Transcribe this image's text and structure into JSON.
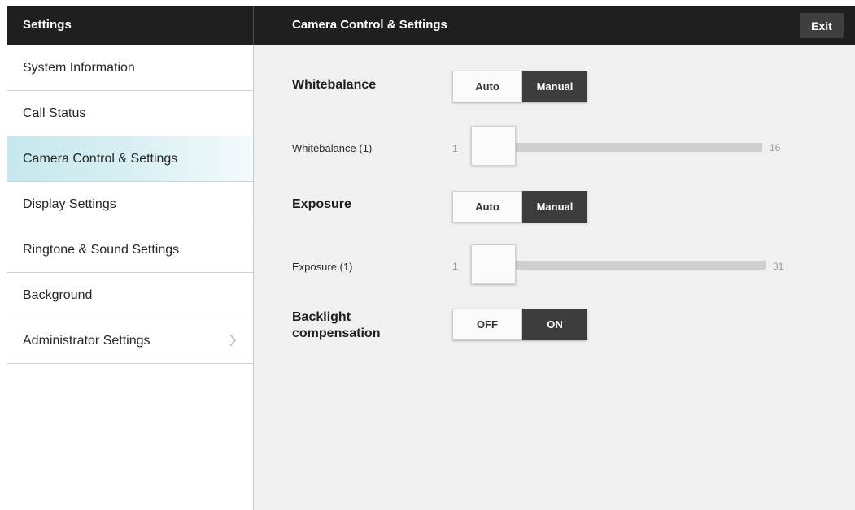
{
  "header": {
    "app_title": "Settings",
    "page_title": "Camera Control & Settings",
    "exit_label": "Exit"
  },
  "sidebar": {
    "items": [
      {
        "label": "System Information"
      },
      {
        "label": "Call Status"
      },
      {
        "label": "Camera Control & Settings",
        "selected": true
      },
      {
        "label": "Display Settings"
      },
      {
        "label": "Ringtone & Sound Settings"
      },
      {
        "label": "Background"
      },
      {
        "label": "Administrator Settings",
        "icon": "chevron-right-icon"
      }
    ]
  },
  "whitebalance": {
    "label": "Whitebalance",
    "options": [
      "Auto",
      "Manual"
    ],
    "selected": "Manual",
    "slider": {
      "label": "Whitebalance (1)",
      "min": "1",
      "max": "16",
      "value": 1
    }
  },
  "exposure": {
    "label": "Exposure",
    "options": [
      "Auto",
      "Manual"
    ],
    "selected": "Manual",
    "slider": {
      "label": "Exposure (1)",
      "min": "1",
      "max": "31",
      "value": 1
    }
  },
  "backlight": {
    "label_line1": "Backlight",
    "label_line2": "compensation",
    "options": [
      "OFF",
      "ON"
    ],
    "selected": "ON"
  },
  "colors": {
    "header_bg": "#1f1f1f",
    "selected_item": "#c5e8ec",
    "active_toggle": "#3d3d3d",
    "content_bg": "#f0f0f0"
  }
}
